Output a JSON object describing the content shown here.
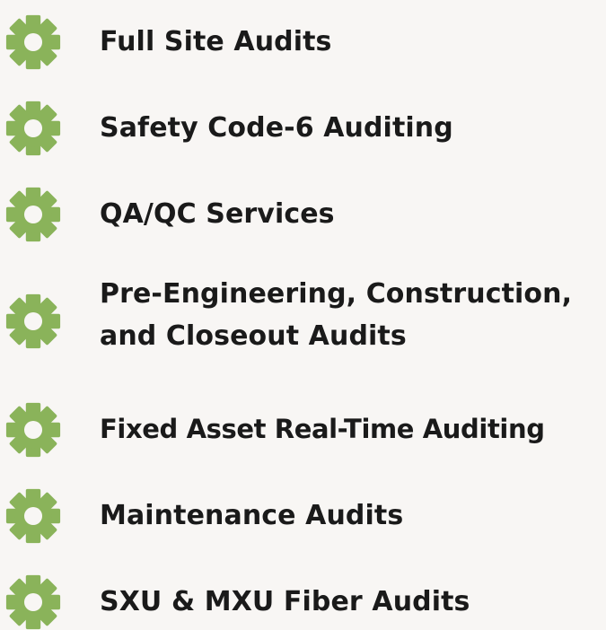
{
  "icon": "gear-icon",
  "colors": {
    "gear": "#8ab35a",
    "text": "#1a1a1a",
    "background": "#f8f6f4"
  },
  "items": [
    {
      "line1": "Full Site Audits",
      "line2": ""
    },
    {
      "line1": "Safety Code-6 Auditing",
      "line2": ""
    },
    {
      "line1": "QA/QC Services",
      "line2": ""
    },
    {
      "line1": "Pre-Engineering, Construction,",
      "line2": "and Closeout Audits"
    },
    {
      "line1": "Fixed Asset Real-Time Auditing",
      "line2": ""
    },
    {
      "line1": "Maintenance Audits",
      "line2": ""
    },
    {
      "line1": "SXU & MXU Fiber Audits",
      "line2": ""
    }
  ]
}
